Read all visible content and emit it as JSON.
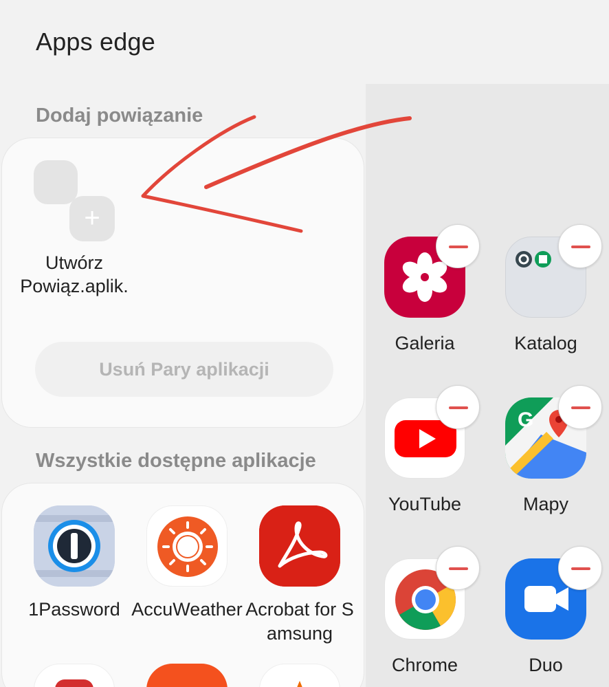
{
  "header": {
    "title": "Apps edge"
  },
  "pair_section": {
    "title": "Dodaj powiązanie",
    "create_label": "Utwórz Powiąz.aplik.",
    "remove_button": "Usuń Pary aplikacji"
  },
  "all_apps_section": {
    "title": "Wszystkie dostępne aplikacje",
    "apps": [
      {
        "label": "1Password",
        "icon": "onepassword-icon"
      },
      {
        "label": "AccuWeather",
        "icon": "accuweather-icon"
      },
      {
        "label": "Acrobat for Samsung",
        "icon": "acrobat-icon"
      }
    ]
  },
  "edge_panel": {
    "apps": [
      {
        "label": "Galeria",
        "icon": "gallery-icon"
      },
      {
        "label": "Katalog",
        "icon": "folder-icon"
      },
      {
        "label": "YouTube",
        "icon": "youtube-icon"
      },
      {
        "label": "Mapy",
        "icon": "maps-icon"
      },
      {
        "label": "Chrome",
        "icon": "chrome-icon"
      },
      {
        "label": "Duo",
        "icon": "duo-icon"
      }
    ]
  },
  "colors": {
    "background": "#f2f2f2",
    "card": "#fafafa",
    "edge_panel": "#e8e8e8",
    "minus_red": "#e0514e",
    "annotation_arrow": "#e2463a"
  }
}
